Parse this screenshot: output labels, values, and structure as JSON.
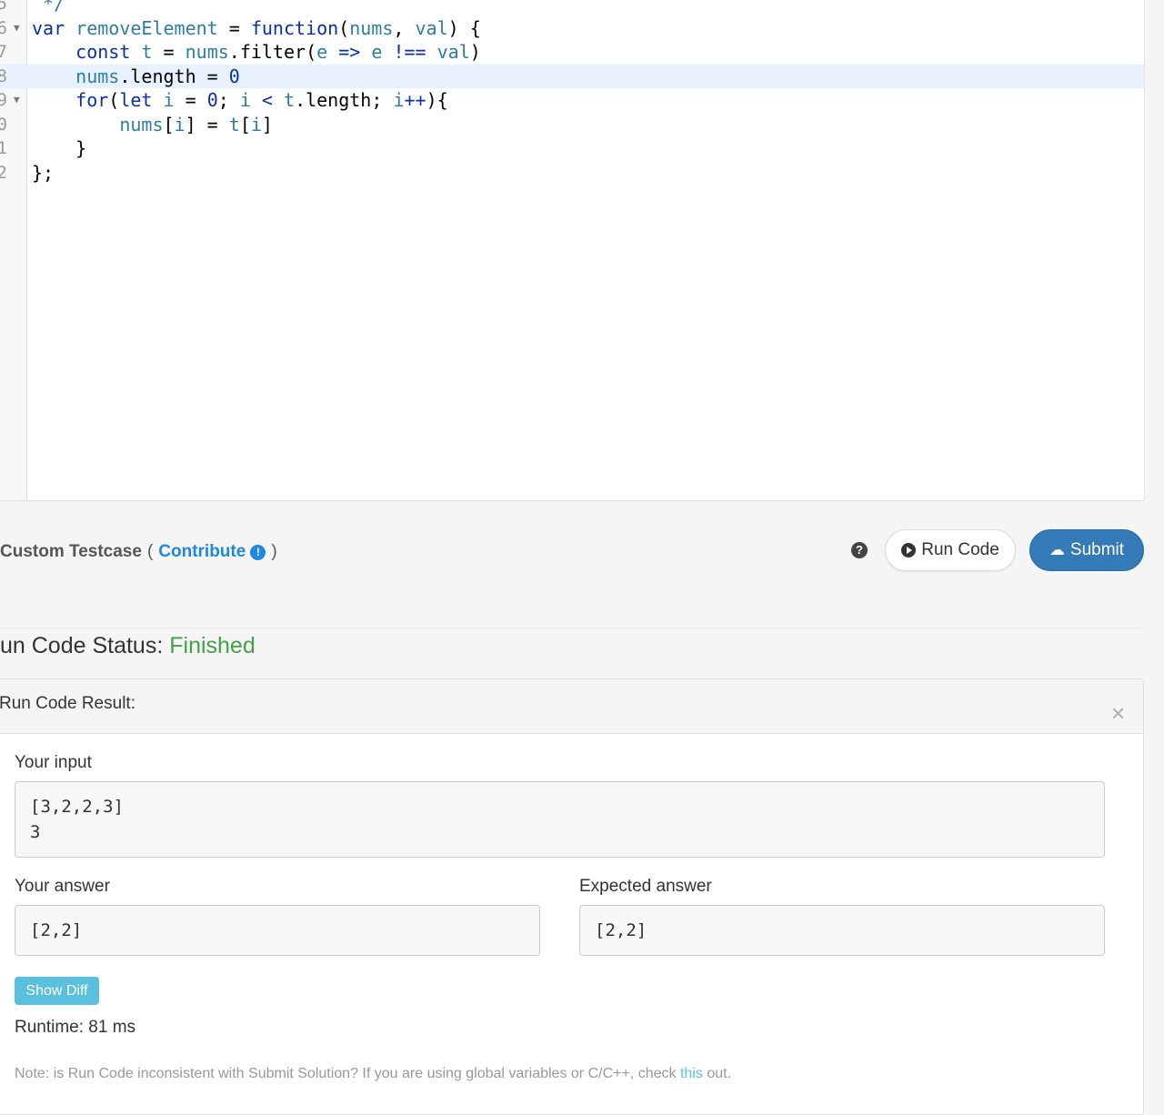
{
  "editor": {
    "line_numbers": [
      "5",
      "6",
      "7",
      "8",
      "9",
      "0",
      "1",
      "2"
    ],
    "active_line_index": 3,
    "fold_markers": [
      "6",
      "9"
    ]
  },
  "toolbar": {
    "custom_testcase": "Custom Testcase",
    "open_paren": "(",
    "contribute": "Contribute",
    "close_paren": ")",
    "run_code": "Run Code",
    "submit": "Submit"
  },
  "status": {
    "label": "un Code Status:",
    "value": "Finished",
    "value_color": "#43a047"
  },
  "result": {
    "title": "Run Code Result:",
    "your_input_label": "Your input",
    "your_input_value": "[3,2,2,3]\n3",
    "your_answer_label": "Your answer",
    "your_answer_value": "[2,2]",
    "expected_answer_label": "Expected answer",
    "expected_answer_value": "[2,2]",
    "show_diff": "Show Diff",
    "runtime": "Runtime: 81 ms",
    "note_prefix": "Note: is Run Code inconsistent with Submit Solution? If you are using global variables or C/C++, check",
    "note_link": "this",
    "note_suffix": "out."
  },
  "colors": {
    "accent_blue": "#1e88e5",
    "submit_blue": "#337ab7",
    "diff_cyan": "#5bc0de"
  }
}
